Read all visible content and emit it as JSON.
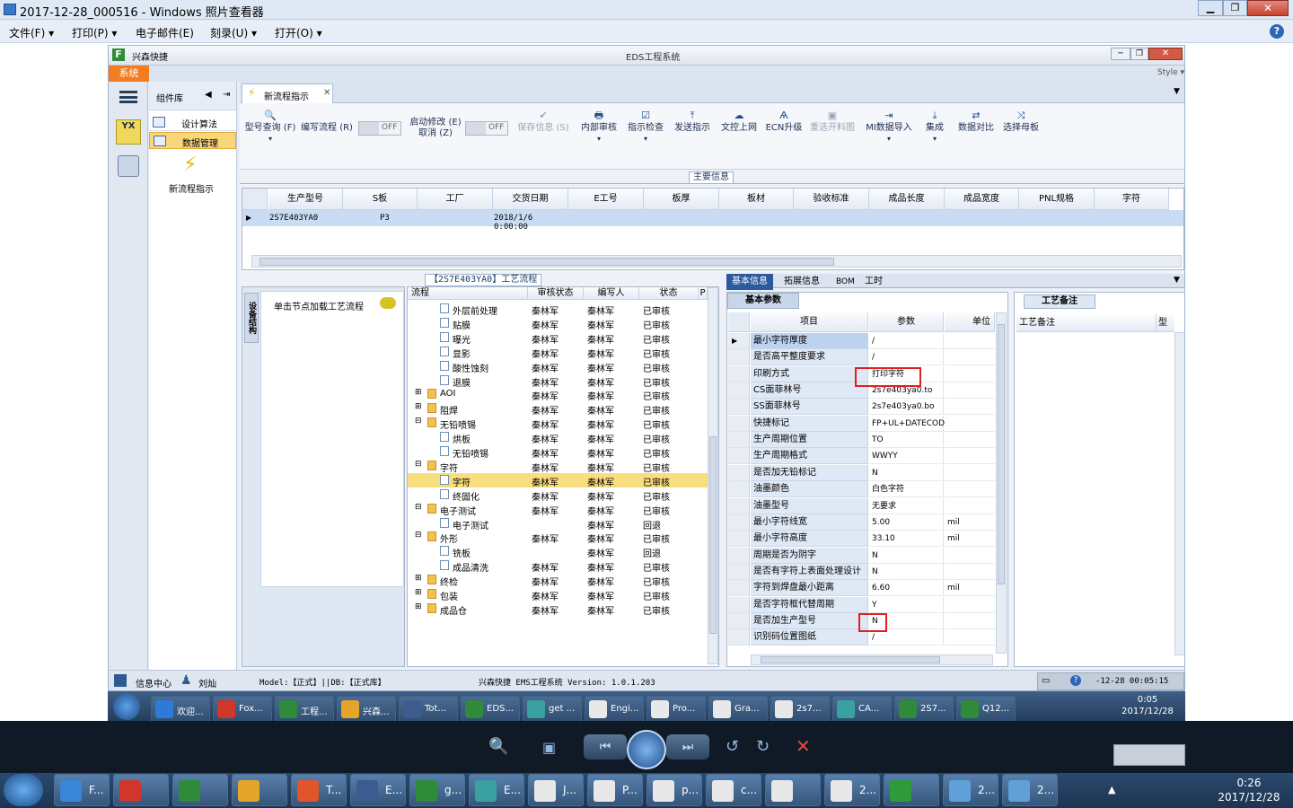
{
  "viewer": {
    "title": "2017-12-28_000516 - Windows 照片查看器",
    "menu": [
      "文件(F)",
      "打印(P)",
      "电子邮件(E)",
      "刻录(U)",
      "打开(O)"
    ],
    "help_icon": "help-icon"
  },
  "app": {
    "brand": "兴森快捷",
    "title": "EDS工程系统",
    "style_label": "Style",
    "system_btn": "系统",
    "component_lib": "组件库",
    "left_items": [
      {
        "label": "设计算法"
      },
      {
        "label": "数据管理"
      }
    ],
    "new_flow_label": "新流程指示",
    "tab_label": "新流程指示",
    "ribbon": {
      "query": "型号查询 (F)",
      "edit_flow": "编写流程 (R)",
      "toggle1": "OFF",
      "auto_modify_line1": "启动修改 (E)",
      "auto_modify_line2": "取消 (Z)",
      "toggle2": "OFF",
      "save": "保存信息 (S)",
      "internal_review": "内部审核",
      "check": "指示检查",
      "send": "发送指示",
      "upload": "文控上网",
      "ecn": "ECN升级",
      "reselect": "重选开料图",
      "mi_import": "MI数据导入",
      "integrate": "集成",
      "compare": "数据对比",
      "select_mother": "选择母板"
    },
    "main_info_label": "主要信息",
    "main_grid": {
      "headers": [
        "生产型号",
        "S板",
        "工厂",
        "交货日期",
        "E工号",
        "板厚",
        "板材",
        "验收标准",
        "成品长度",
        "成品宽度",
        "PNL规格",
        "字符"
      ],
      "row": [
        "2S7E403YA0",
        "",
        "P3",
        "2018/1/6 0:00:00",
        "",
        "",
        "",
        "",
        "",
        "",
        "",
        ""
      ]
    },
    "process_label": "【2S7E403YA0】工艺流程",
    "side_tab": "设备结构",
    "load_hint": "单击节点加载工艺流程",
    "tree": {
      "headers": [
        "流程",
        "审核状态",
        "编写人",
        "状态",
        "P"
      ],
      "rows": [
        {
          "name": "外层前处理",
          "level": 2,
          "reviewer": "秦林军",
          "writer": "秦林军",
          "status": "已审核"
        },
        {
          "name": "贴膜",
          "level": 2,
          "reviewer": "秦林军",
          "writer": "秦林军",
          "status": "已审核"
        },
        {
          "name": "曝光",
          "level": 2,
          "reviewer": "秦林军",
          "writer": "秦林军",
          "status": "已审核"
        },
        {
          "name": "显影",
          "level": 2,
          "reviewer": "秦林军",
          "writer": "秦林军",
          "status": "已审核"
        },
        {
          "name": "酸性蚀刻",
          "level": 2,
          "reviewer": "秦林军",
          "writer": "秦林军",
          "status": "已审核"
        },
        {
          "name": "退膜",
          "level": 2,
          "reviewer": "秦林军",
          "writer": "秦林军",
          "status": "已审核"
        },
        {
          "name": "AOI",
          "level": 1,
          "reviewer": "秦林军",
          "writer": "秦林军",
          "status": "已审核"
        },
        {
          "name": "阻焊",
          "level": 1,
          "reviewer": "秦林军",
          "writer": "秦林军",
          "status": "已审核"
        },
        {
          "name": "无铅喷锡",
          "level": 1,
          "reviewer": "秦林军",
          "writer": "秦林军",
          "status": "已审核"
        },
        {
          "name": "烘板",
          "level": 2,
          "reviewer": "秦林军",
          "writer": "秦林军",
          "status": "已审核"
        },
        {
          "name": "无铅喷锡",
          "level": 2,
          "reviewer": "秦林军",
          "writer": "秦林军",
          "status": "已审核"
        },
        {
          "name": "字符",
          "level": 1,
          "reviewer": "秦林军",
          "writer": "秦林军",
          "status": "已审核"
        },
        {
          "name": "字符",
          "level": 2,
          "reviewer": "秦林军",
          "writer": "秦林军",
          "status": "已审核",
          "selected": true
        },
        {
          "name": "终固化",
          "level": 2,
          "reviewer": "秦林军",
          "writer": "秦林军",
          "status": "已审核"
        },
        {
          "name": "电子测试",
          "level": 1,
          "reviewer": "秦林军",
          "writer": "秦林军",
          "status": "已审核"
        },
        {
          "name": "电子测试",
          "level": 2,
          "reviewer": "",
          "writer": "秦林军",
          "status": "回退"
        },
        {
          "name": "外形",
          "level": 1,
          "reviewer": "秦林军",
          "writer": "秦林军",
          "status": "已审核"
        },
        {
          "name": "铣板",
          "level": 2,
          "reviewer": "",
          "writer": "秦林军",
          "status": "回退"
        },
        {
          "name": "成品清洗",
          "level": 2,
          "reviewer": "秦林军",
          "writer": "秦林军",
          "status": "已审核"
        },
        {
          "name": "终检",
          "level": 1,
          "reviewer": "秦林军",
          "writer": "秦林军",
          "status": "已审核"
        },
        {
          "name": "包装",
          "level": 1,
          "reviewer": "秦林军",
          "writer": "秦林军",
          "status": "已审核"
        },
        {
          "name": "成品仓",
          "level": 1,
          "reviewer": "秦林军",
          "writer": "秦林军",
          "status": "已审核"
        }
      ]
    },
    "detail_tabs": [
      "基本信息",
      "拓展信息",
      "BOM",
      "工时"
    ],
    "basic_params_label": "基本参数",
    "params_headers": [
      "项目",
      "参数",
      "单位"
    ],
    "params": [
      {
        "item": "最小字符厚度",
        "value": "/",
        "unit": ""
      },
      {
        "item": "是否高平整度要求",
        "value": "/",
        "unit": ""
      },
      {
        "item": "印刷方式",
        "value": "打印字符",
        "unit": ""
      },
      {
        "item": "CS面菲林号",
        "value": "2s7e403ya0.to",
        "unit": ""
      },
      {
        "item": "SS面菲林号",
        "value": "2s7e403ya0.bo",
        "unit": ""
      },
      {
        "item": "快捷标记",
        "value": "FP+UL+DATECODE",
        "unit": ""
      },
      {
        "item": "生产周期位置",
        "value": "TO",
        "unit": ""
      },
      {
        "item": "生产周期格式",
        "value": "WWYY",
        "unit": ""
      },
      {
        "item": "是否加无铅标记",
        "value": "N",
        "unit": ""
      },
      {
        "item": "油墨颜色",
        "value": "白色字符",
        "unit": ""
      },
      {
        "item": "油墨型号",
        "value": "无要求",
        "unit": ""
      },
      {
        "item": "最小字符线宽",
        "value": "5.00",
        "unit": "mil"
      },
      {
        "item": "最小字符高度",
        "value": "33.10",
        "unit": "mil"
      },
      {
        "item": "周期是否为阴字",
        "value": "N",
        "unit": ""
      },
      {
        "item": "是否有字符上表面处理设计",
        "value": "N",
        "unit": ""
      },
      {
        "item": "字符到焊盘最小距离",
        "value": "6.60",
        "unit": "mil"
      },
      {
        "item": "是否字符框代替周期",
        "value": "Y",
        "unit": ""
      },
      {
        "item": "是否加生产型号",
        "value": "N",
        "unit": ""
      },
      {
        "item": "识别码位置图纸",
        "value": "/",
        "unit": ""
      }
    ],
    "remarks_label": "工艺备注",
    "remarks_header": "工艺备注",
    "remarks_header2": "型",
    "status": {
      "info_center": "信息中心",
      "user": "刘灿",
      "model": "Model:【正式】||DB:【正式库】",
      "version": "兴森快捷 EMS工程系统 Version: 1.0.1.203",
      "time": "-12-28 00:05:15"
    }
  },
  "inner_taskbar": {
    "items": [
      "欢迎...",
      "Fox...",
      "工程...",
      "兴森...",
      "Tot...",
      "EDS...",
      "get ...",
      "Engi...",
      "Pro...",
      "Gra...",
      "2s7...",
      "CA...",
      "2S7...",
      "Q12..."
    ],
    "time": "0:05",
    "date": "2017/12/28"
  },
  "outer_taskbar": {
    "items": [
      "F...",
      "",
      "",
      "",
      "T...",
      "E...",
      "g...",
      "E...",
      "J...",
      "P...",
      "p...",
      "c...",
      "",
      "2...",
      "",
      "2...",
      "2..."
    ],
    "time": "0:26",
    "date": "2017/12/28"
  }
}
